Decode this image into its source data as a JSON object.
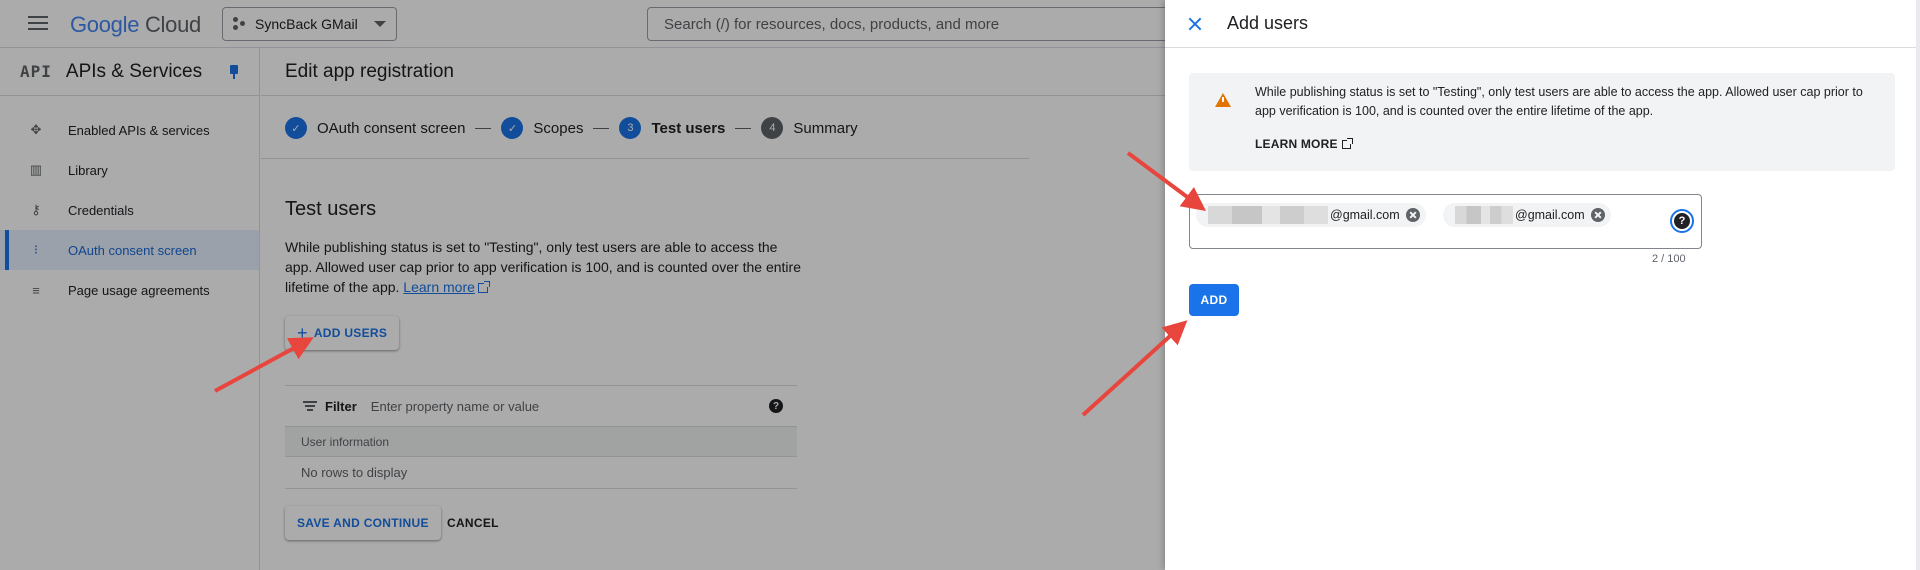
{
  "topbar": {
    "logo_google": "Google",
    "logo_cloud": "Cloud",
    "project_name": "SyncBack GMail",
    "search_placeholder": "Search (/) for resources, docs, products, and more"
  },
  "sidebar": {
    "badge": "API",
    "title": "APIs & Services",
    "items": [
      {
        "label": "Enabled APIs & services",
        "icon": "apis-icon"
      },
      {
        "label": "Library",
        "icon": "library-icon"
      },
      {
        "label": "Credentials",
        "icon": "key-icon"
      },
      {
        "label": "OAuth consent screen",
        "icon": "consent-icon",
        "active": true
      },
      {
        "label": "Page usage agreements",
        "icon": "agreements-icon"
      }
    ]
  },
  "main": {
    "page_title": "Edit app registration",
    "steps": [
      {
        "number": "✓",
        "label": "OAuth consent screen",
        "state": "done"
      },
      {
        "number": "✓",
        "label": "Scopes",
        "state": "done"
      },
      {
        "number": "3",
        "label": "Test users",
        "state": "current"
      },
      {
        "number": "4",
        "label": "Summary",
        "state": "todo"
      }
    ],
    "section_title": "Test users",
    "description": "While publishing status is set to \"Testing\", only test users are able to access the app. Allowed user cap prior to app verification is 100, and is counted over the entire lifetime of the app.",
    "learn_more": "Learn more",
    "add_users_label": "ADD USERS",
    "filter_label": "Filter",
    "filter_placeholder": "Enter property name or value",
    "table_header": "User information",
    "table_empty": "No rows to display",
    "save_label": "SAVE AND CONTINUE",
    "cancel_label": "CANCEL"
  },
  "panel": {
    "title": "Add users",
    "notice": "While publishing status is set to \"Testing\", only test users are able to access the app. Allowed user cap prior to app verification is 100, and is counted over the entire lifetime of the app.",
    "learn_more": "LEARN MORE",
    "chips": [
      {
        "suffix": "@gmail.com"
      },
      {
        "suffix": "@gmail.com"
      }
    ],
    "counter": "2 / 100",
    "add_label": "ADD"
  },
  "colors": {
    "accent": "#1a73e8",
    "warning": "#e37400",
    "annotation_arrow": "#e8453c"
  }
}
